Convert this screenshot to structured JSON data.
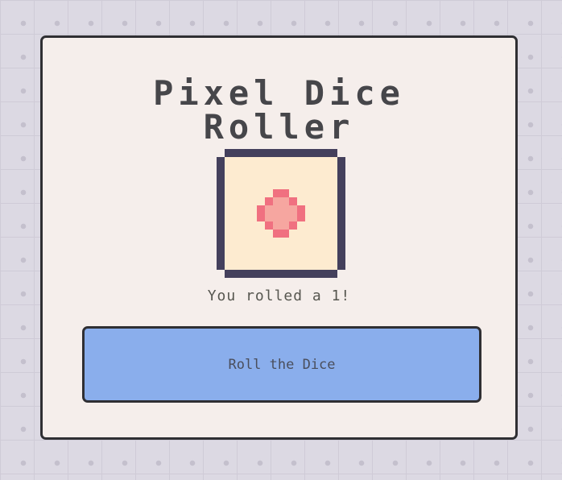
{
  "app": {
    "title_line1": "Pixel Dice",
    "title_line2": "Roller"
  },
  "die": {
    "face_value": 1,
    "frame_color": "#44405c",
    "face_color": "#fdebd0",
    "pip_color": "#f07080",
    "pip_highlight_color": "#f6a6a0"
  },
  "result": {
    "text": "You rolled a 1!"
  },
  "controls": {
    "roll_label": "Roll the Dice",
    "button_color": "#8aaeec"
  }
}
